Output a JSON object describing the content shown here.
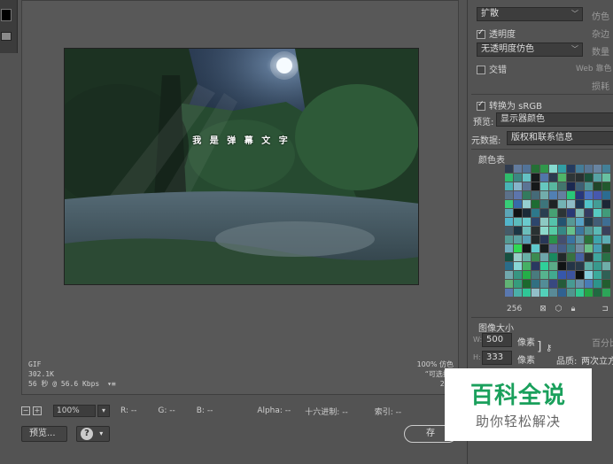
{
  "canvas": {
    "overlay_text": "我 是 弹 幕 文 字"
  },
  "info_left": {
    "format": "GIF",
    "size": "302.1K",
    "download": "56 秒 @ 56.6 Kbps",
    "menu_glyph": "▾≡"
  },
  "info_right": {
    "dither": "100% 仿色",
    "palette": "“可选择”",
    "colors": "256"
  },
  "status_bar": {
    "zoom": "100%",
    "r": "R: --",
    "g": "G: --",
    "b": "B: --",
    "alpha": "Alpha: --",
    "hex": "十六进制: --",
    "index": "索引: --"
  },
  "buttons": {
    "preview": "预览...",
    "help": "?",
    "save": "存"
  },
  "right_panel": {
    "diffusion": "扩散",
    "dither_label": "仿色",
    "transparency": "透明度",
    "matte_label": "杂边",
    "no_transparency_dither": "无透明度仿色",
    "amount_label": "数量",
    "interlaced": "交错",
    "web_snap": "Web 靠色",
    "lossy": "损耗",
    "convert_srgb": "转换为 sRGB",
    "preview_label": "预览:",
    "preview_value": "显示器颜色",
    "metadata_label": "元数据:",
    "metadata_value": "版权和联系信息",
    "color_table": "颜色表",
    "color_count": "256",
    "image_size": "图像大小",
    "w_label": "W:",
    "w_value": "500",
    "h_label": "H:",
    "h_value": "333",
    "px": "像素",
    "percent": "百分比",
    "quality_label": "品质:",
    "quality_value": "两次立方"
  },
  "watermark": {
    "title": "百科全说",
    "subtitle": "助你轻松解决"
  }
}
